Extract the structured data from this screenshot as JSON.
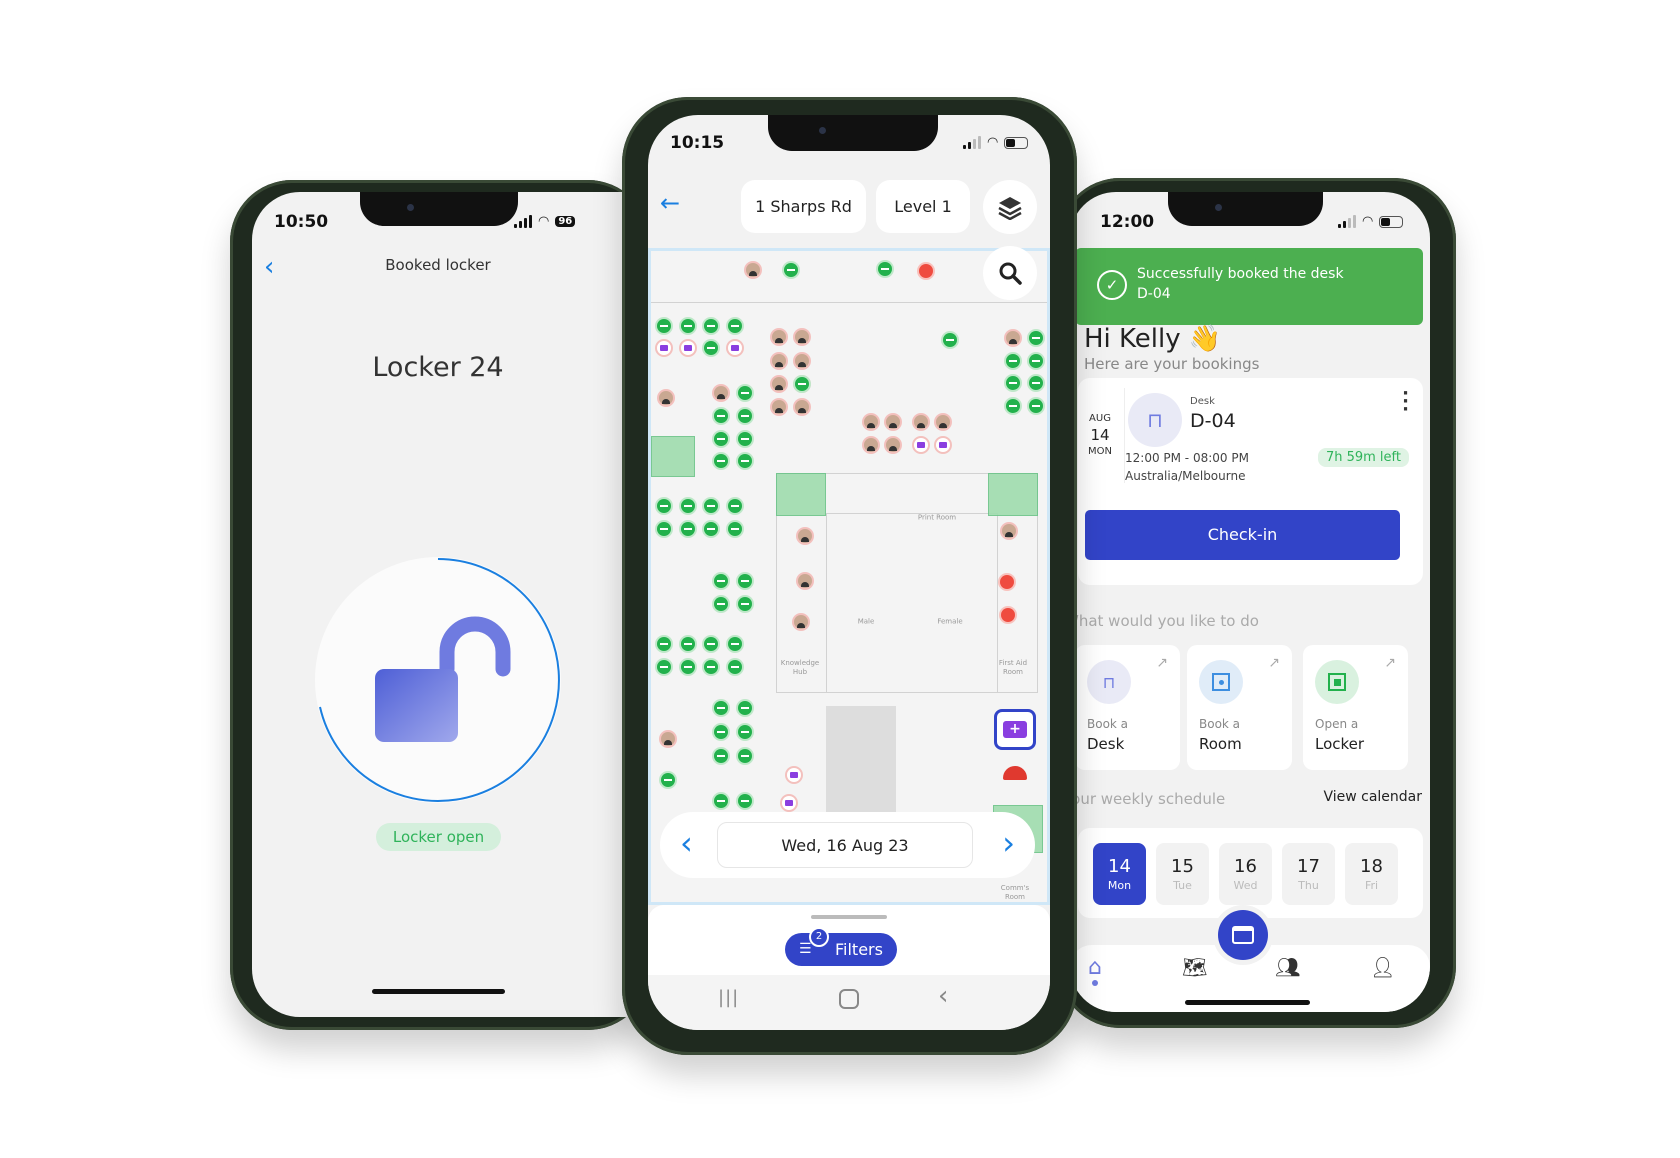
{
  "left_phone": {
    "status_time": "10:50",
    "battery": "96",
    "title": "Booked locker",
    "locker_name": "Locker 24",
    "status_badge": "Locker open",
    "lock_icon": "lock-open-icon"
  },
  "center_phone": {
    "status_time": "10:15",
    "location": "1 Sharps Rd",
    "level": "Level 1",
    "date": "Wed, 16 Aug 23",
    "filters_label": "Filters",
    "filters_count": "2",
    "rooms": {
      "print": "Print Room",
      "male": "Male",
      "female": "Female",
      "knowledge": "Knowledge Hub",
      "first_aid": "First Aid Room",
      "comms": "Comm's Room"
    },
    "colors": {
      "available": "#22b14c",
      "occupied_initials": "#ef4b3f",
      "accent": "#3244c8",
      "first_aid": "#8a3ee0"
    }
  },
  "right_phone": {
    "status_time": "12:00",
    "toast": {
      "line1": "Successfully booked the desk",
      "line2": "D-04"
    },
    "greeting": "Hi Kelly 👋",
    "subtitle": "Here are your bookings",
    "booking": {
      "month": "AUG",
      "day": "14",
      "weekday": "MON",
      "type": "Desk",
      "name": "D-04",
      "time": "12:00 PM - 08:00 PM",
      "timezone": "Australia/Melbourne",
      "remaining": "7h 59m left",
      "checkin_label": "Check-in"
    },
    "actions_title": "What would you like to do",
    "actions": [
      {
        "line1": "Book a",
        "line2": "Desk"
      },
      {
        "line1": "Book a",
        "line2": "Room"
      },
      {
        "line1": "Open a",
        "line2": "Locker"
      }
    ],
    "schedule_title": "Your weekly schedule",
    "view_calendar": "View calendar",
    "days": [
      {
        "num": "14",
        "wd": "Mon",
        "selected": true
      },
      {
        "num": "15",
        "wd": "Tue"
      },
      {
        "num": "16",
        "wd": "Wed"
      },
      {
        "num": "17",
        "wd": "Thu"
      },
      {
        "num": "18",
        "wd": "Fri"
      }
    ],
    "nav": [
      "home-icon",
      "map-icon",
      "people-icon",
      "profile-icon"
    ],
    "colors": {
      "toast": "#4caf50",
      "primary": "#3244c8",
      "badge_text": "#2fb35a"
    }
  }
}
